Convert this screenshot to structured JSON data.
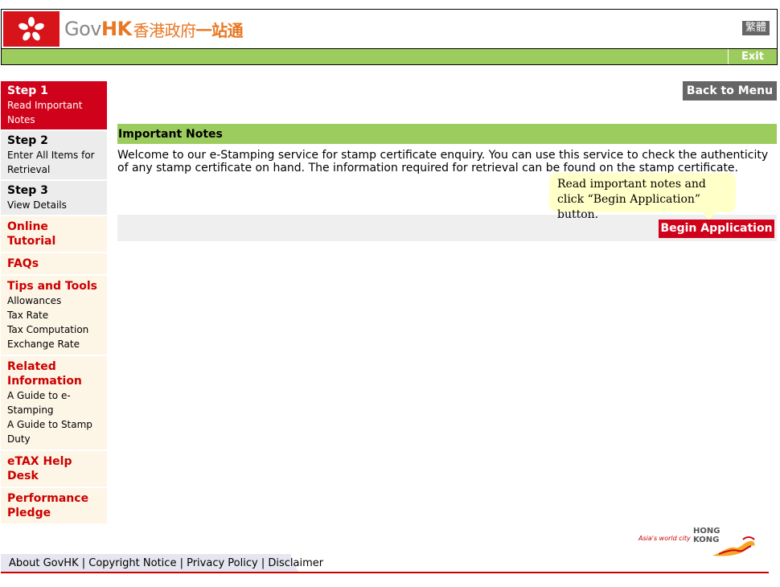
{
  "header": {
    "brand_gov": "Gov",
    "brand_hk": "HK",
    "brand_cn1": "香港政府",
    "brand_cn2": "一站通",
    "lang_label": "繁體",
    "exit_label": "Exit"
  },
  "sidebar": {
    "steps": [
      {
        "title": "Step 1",
        "desc": "Read Important Notes",
        "active": true
      },
      {
        "title": "Step 2",
        "desc": "Enter All Items for Retrieval",
        "active": false
      },
      {
        "title": "Step 3",
        "desc": "View Details",
        "active": false
      }
    ],
    "online_tutorial": "Online Tutorial",
    "faqs": "FAQs",
    "tips_title": "Tips and Tools",
    "tips_items": [
      "Allowances",
      "Tax Rate",
      "Tax Computation",
      "Exchange Rate"
    ],
    "related_title": "Related Information",
    "related_items": [
      "A Guide to e-Stamping",
      "A Guide to Stamp Duty"
    ],
    "help_desk": "eTAX Help Desk",
    "pledge": "Performance Pledge"
  },
  "main": {
    "back_label": "Back to Menu",
    "section_title": "Important Notes",
    "notes_text": "Welcome to our e-Stamping service for stamp certificate enquiry. You can use this service to check the authenticity of any stamp certificate on hand. The information required for retrieval can be found on the stamp certificate.",
    "tooltip_line1": "Read important notes and",
    "tooltip_line2": "click “Begin Application” button.",
    "begin_label": "Begin Application"
  },
  "footer": {
    "links": [
      "About GovHK",
      "Copyright Notice",
      "Privacy Policy",
      "Disclaimer"
    ],
    "separator": " | ",
    "hk_tagline": "Asia's world city",
    "hk_word1": "HONG",
    "hk_word2": "KONG"
  },
  "colors": {
    "brand_red": "#d0021b",
    "green_bar": "#9dcc5e",
    "orange": "#e87722",
    "gray_button": "#666666"
  }
}
